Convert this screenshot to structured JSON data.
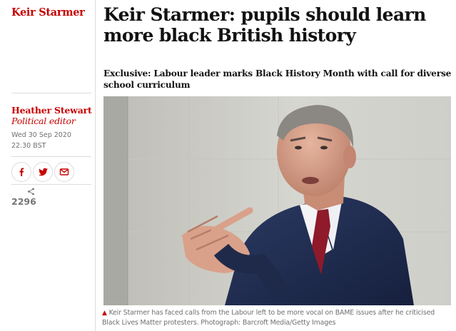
{
  "section": {
    "label": "Keir Starmer"
  },
  "article": {
    "headline": "Keir Starmer: pupils should learn more black British history",
    "standfirst": "Exclusive: Labour leader marks Black History Month with call for diverse school curriculum"
  },
  "byline": {
    "name": "Heather Stewart",
    "role": "Political editor",
    "date": "Wed 30 Sep 2020 22.30 BST"
  },
  "share": {
    "buttons": [
      {
        "icon": "facebook-icon"
      },
      {
        "icon": "twitter-icon"
      },
      {
        "icon": "email-icon"
      }
    ],
    "count": "2296"
  },
  "photo": {
    "caption": "Keir Starmer has faced calls from the Labour left to be more vocal on BAME issues after he criticised Black Lives Matter protesters. Photograph: Barcroft Media/Getty Images"
  },
  "colors": {
    "accent": "#c70000",
    "text": "#121212",
    "muted": "#707070",
    "rule": "#dcdcdc"
  }
}
